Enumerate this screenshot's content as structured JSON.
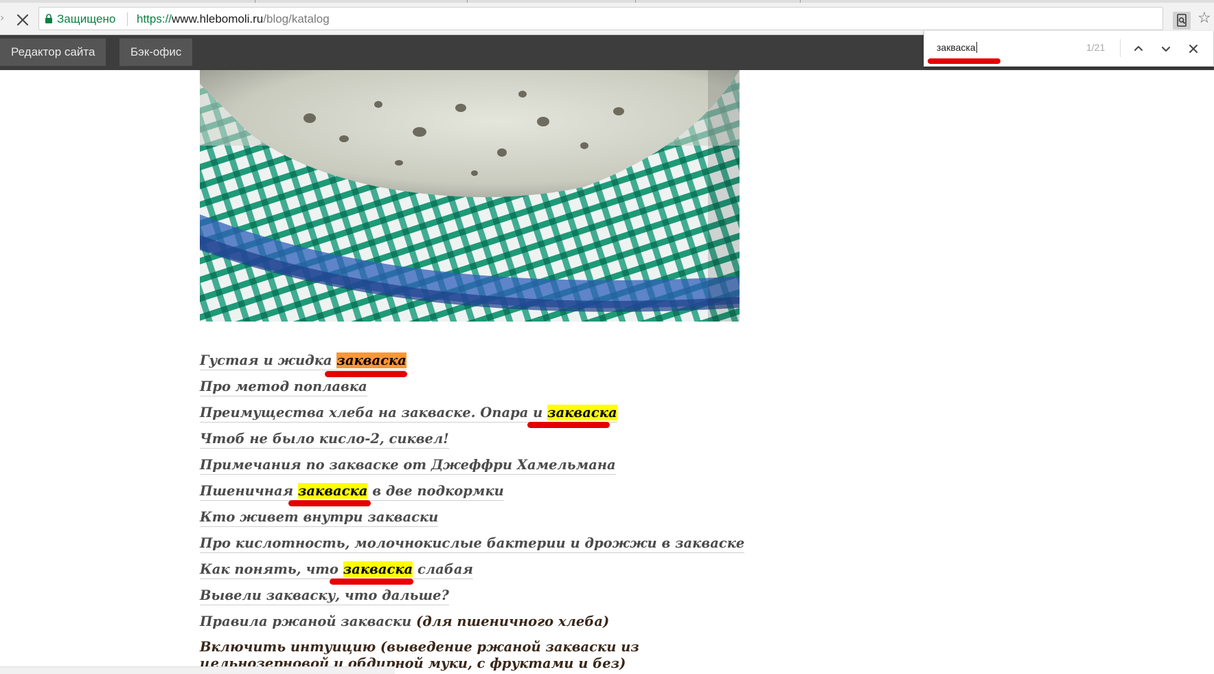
{
  "browser": {
    "secure_label": "Защищено",
    "url_scheme": "https://",
    "url_host": "www.hlebomoli.ru",
    "url_path": "/blog/katalog"
  },
  "adminbar": {
    "site_editor_label": "Редактор сайта",
    "back_office_label": "Бэк-офис"
  },
  "findbar": {
    "query": "закваска",
    "count": "1/21"
  },
  "articles": [
    {
      "before": "Густая и жидка ",
      "match": "закваска",
      "after": ""
    },
    {
      "before": "Про метод поплавка",
      "match": "",
      "after": ""
    },
    {
      "before": "Преимущества хлеба на закваске. Опара и ",
      "match": "закваска",
      "after": ""
    },
    {
      "before": "Чтоб не было кисло-2, сиквел!",
      "match": "",
      "after": ""
    },
    {
      "before": "Примечания по закваске от Джеффри Хамельмана",
      "match": "",
      "after": ""
    },
    {
      "before": "Пшеничная ",
      "match": "закваска",
      "after": " в две подкормки"
    },
    {
      "before": "Кто живет внутри закваски",
      "match": "",
      "after": ""
    },
    {
      "before": "Про кислотность, молочнокислые бактерии и дрожжи в закваске",
      "match": "",
      "after": ""
    },
    {
      "before": "Как понять, что ",
      "match": "закваска",
      "after": " слабая"
    },
    {
      "before": "Вывели закваску, что дальше?",
      "match": "",
      "after": ""
    },
    {
      "before": "Правила ржаной закваски",
      "extra": " (для пшеничного хлеба)"
    },
    {
      "before": "Включить интуицию (выведение ржаной закваски из цельнозерновой и обдирной муки, с фруктами и без)"
    }
  ],
  "colors": {
    "highlight": "#ffff00",
    "highlight_active": "#ff9632",
    "annotation": "#e60000",
    "admin_bar": "#3d3d3d",
    "secure_green": "#0b8043"
  },
  "icons": {
    "back": "arrow-left-icon",
    "stop": "close-icon",
    "lock": "lock-icon",
    "find": "find-in-page-icon",
    "bookmark": "star-icon",
    "find_prev": "chevron-up-icon",
    "find_next": "chevron-down-icon",
    "find_close": "close-icon"
  }
}
